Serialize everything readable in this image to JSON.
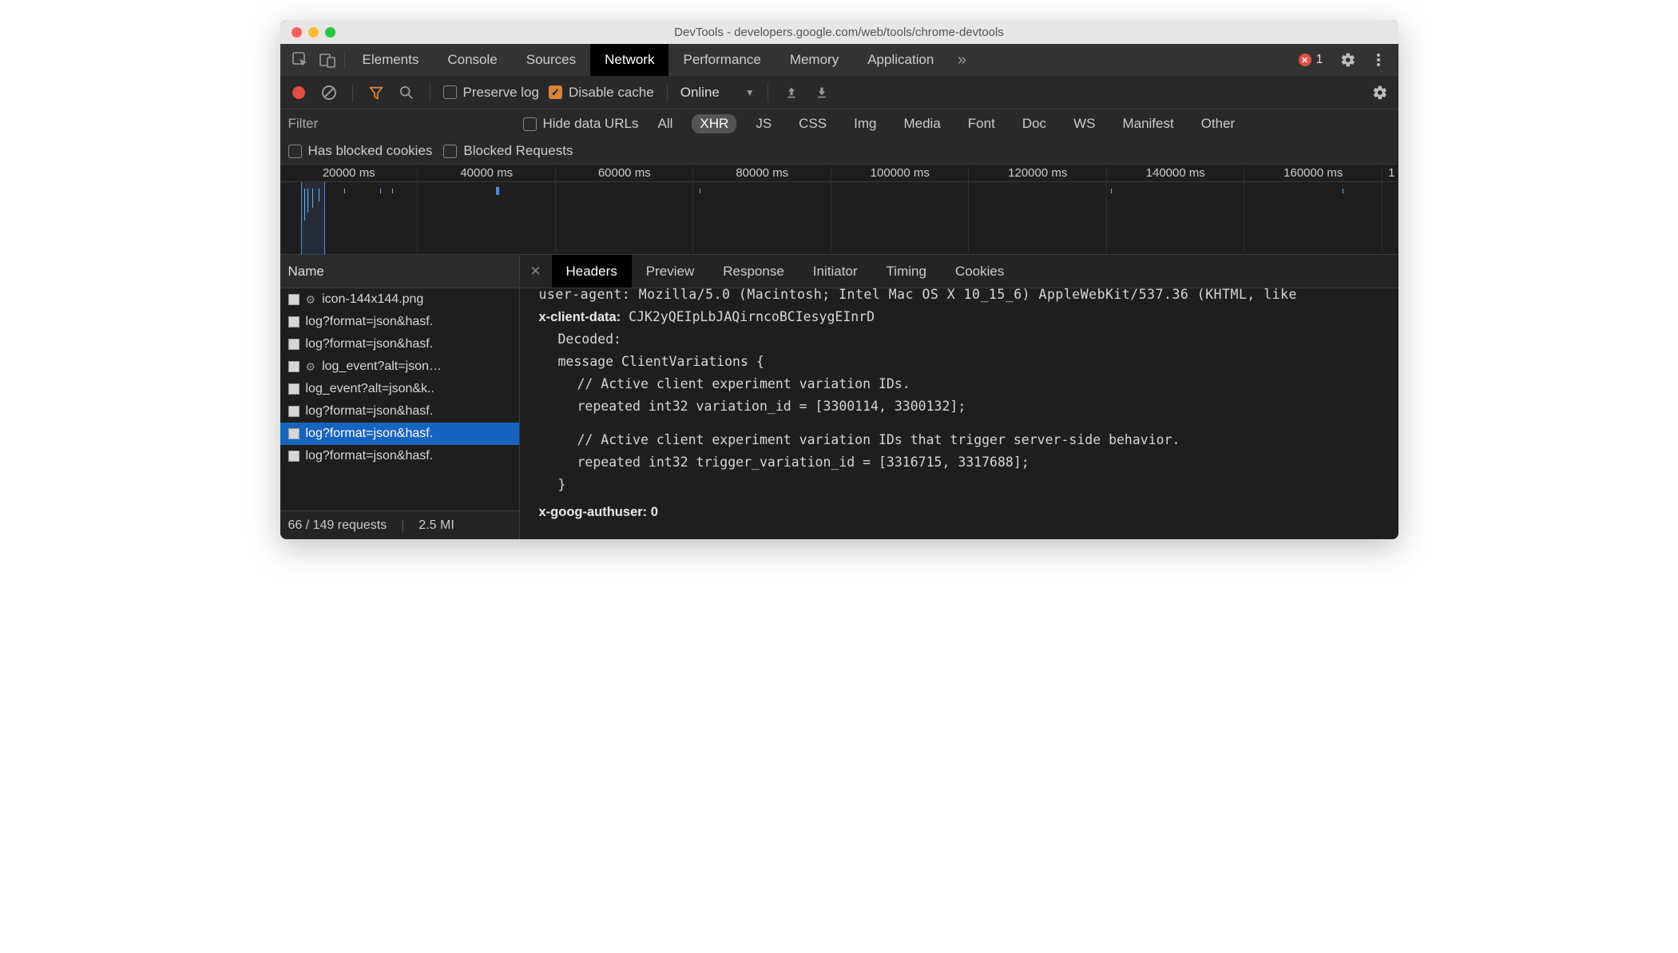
{
  "titlebar": {
    "title": "DevTools - developers.google.com/web/tools/chrome-devtools"
  },
  "main_tabs": {
    "items": [
      "Elements",
      "Console",
      "Sources",
      "Network",
      "Performance",
      "Memory",
      "Application"
    ],
    "active": "Network",
    "error_count": "1"
  },
  "network_toolbar": {
    "preserve_log": "Preserve log",
    "disable_cache": "Disable cache",
    "throttling": "Online"
  },
  "filter_row": {
    "placeholder": "Filter",
    "hide_data_urls": "Hide data URLs",
    "types": [
      "All",
      "XHR",
      "JS",
      "CSS",
      "Img",
      "Media",
      "Font",
      "Doc",
      "WS",
      "Manifest",
      "Other"
    ],
    "active_type": "XHR",
    "has_blocked_cookies": "Has blocked cookies",
    "blocked_requests": "Blocked Requests"
  },
  "timeline": {
    "ticks": [
      "20000 ms",
      "40000 ms",
      "60000 ms",
      "80000 ms",
      "100000 ms",
      "120000 ms",
      "140000 ms",
      "160000 ms",
      "1"
    ]
  },
  "requests": {
    "column": "Name",
    "items": [
      {
        "name": "icon-144x144.png",
        "gear": true
      },
      {
        "name": "log?format=json&hasf.",
        "gear": false
      },
      {
        "name": "log?format=json&hasf.",
        "gear": false
      },
      {
        "name": "log_event?alt=json…",
        "gear": true
      },
      {
        "name": "log_event?alt=json&k..",
        "gear": false
      },
      {
        "name": "log?format=json&hasf.",
        "gear": false
      },
      {
        "name": "log?format=json&hasf.",
        "gear": false,
        "selected": true
      },
      {
        "name": "log?format=json&hasf.",
        "gear": false
      }
    ],
    "status_requests": "66 / 149 requests",
    "status_size": "2.5 MI"
  },
  "detail": {
    "tabs": [
      "Headers",
      "Preview",
      "Response",
      "Initiator",
      "Timing",
      "Cookies"
    ],
    "active": "Headers",
    "user_agent_line": "user-agent: Mozilla/5.0 (Macintosh; Intel Mac OS X 10_15_6) AppleWebKit/537.36 (KHTML, like",
    "x_client_data_label": "x-client-data:",
    "x_client_data_value": "CJK2yQEIpLbJAQirncoBCIesygEInrD",
    "decoded_label": "Decoded:",
    "message_open": "message ClientVariations {",
    "comment1": "// Active client experiment variation IDs.",
    "line1": "repeated int32 variation_id = [3300114, 3300132];",
    "comment2": "// Active client experiment variation IDs that trigger server-side behavior.",
    "line2": "repeated int32 trigger_variation_id = [3316715, 3317688];",
    "message_close": "}",
    "x_goog_authuser": "x-goog-authuser: 0"
  }
}
